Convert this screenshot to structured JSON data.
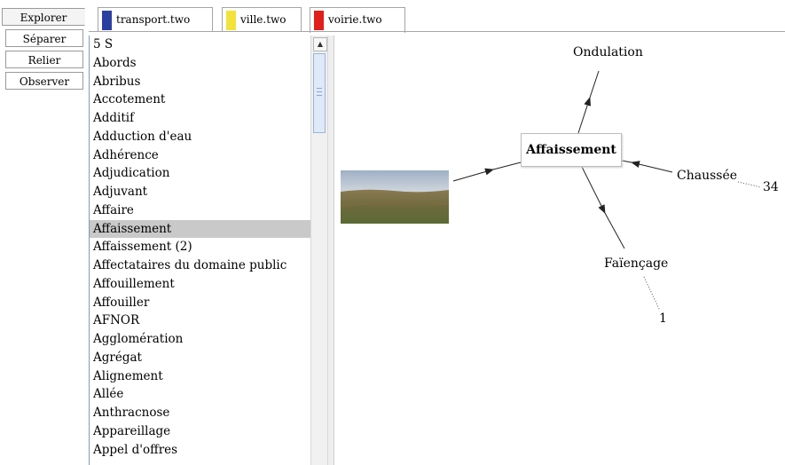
{
  "side_tabs": [
    "Explorer",
    "Séparer",
    "Relier",
    "Observer"
  ],
  "file_tabs": [
    {
      "label": "transport.two",
      "color": "#2b3fa0"
    },
    {
      "label": "ville.two",
      "color": "#f2e23a"
    },
    {
      "label": "voirie.two",
      "color": "#e0201a"
    }
  ],
  "list_items": [
    "5 S",
    "Abords",
    "Abribus",
    "Accotement",
    "Additif",
    "Adduction d'eau",
    "Adhérence",
    "Adjudication",
    "Adjuvant",
    "Affaire",
    "Affaissement",
    "Affaissement (2)",
    "Affectataires du domaine public",
    "Affouillement",
    "Affouiller",
    "AFNOR",
    "Agglomération",
    "Agrégat",
    "Alignement",
    "Allée",
    "Anthracnose",
    "Appareillage",
    "Appel d'offres"
  ],
  "selected_item": "Affaissement",
  "graph": {
    "center": "Affaissement",
    "ondulation": "Ondulation",
    "chaussee": "Chaussée",
    "chaussee_count": "34",
    "faiencage": "Faïençage",
    "faiencage_count": "1"
  },
  "scroll_up_glyph": "▲"
}
